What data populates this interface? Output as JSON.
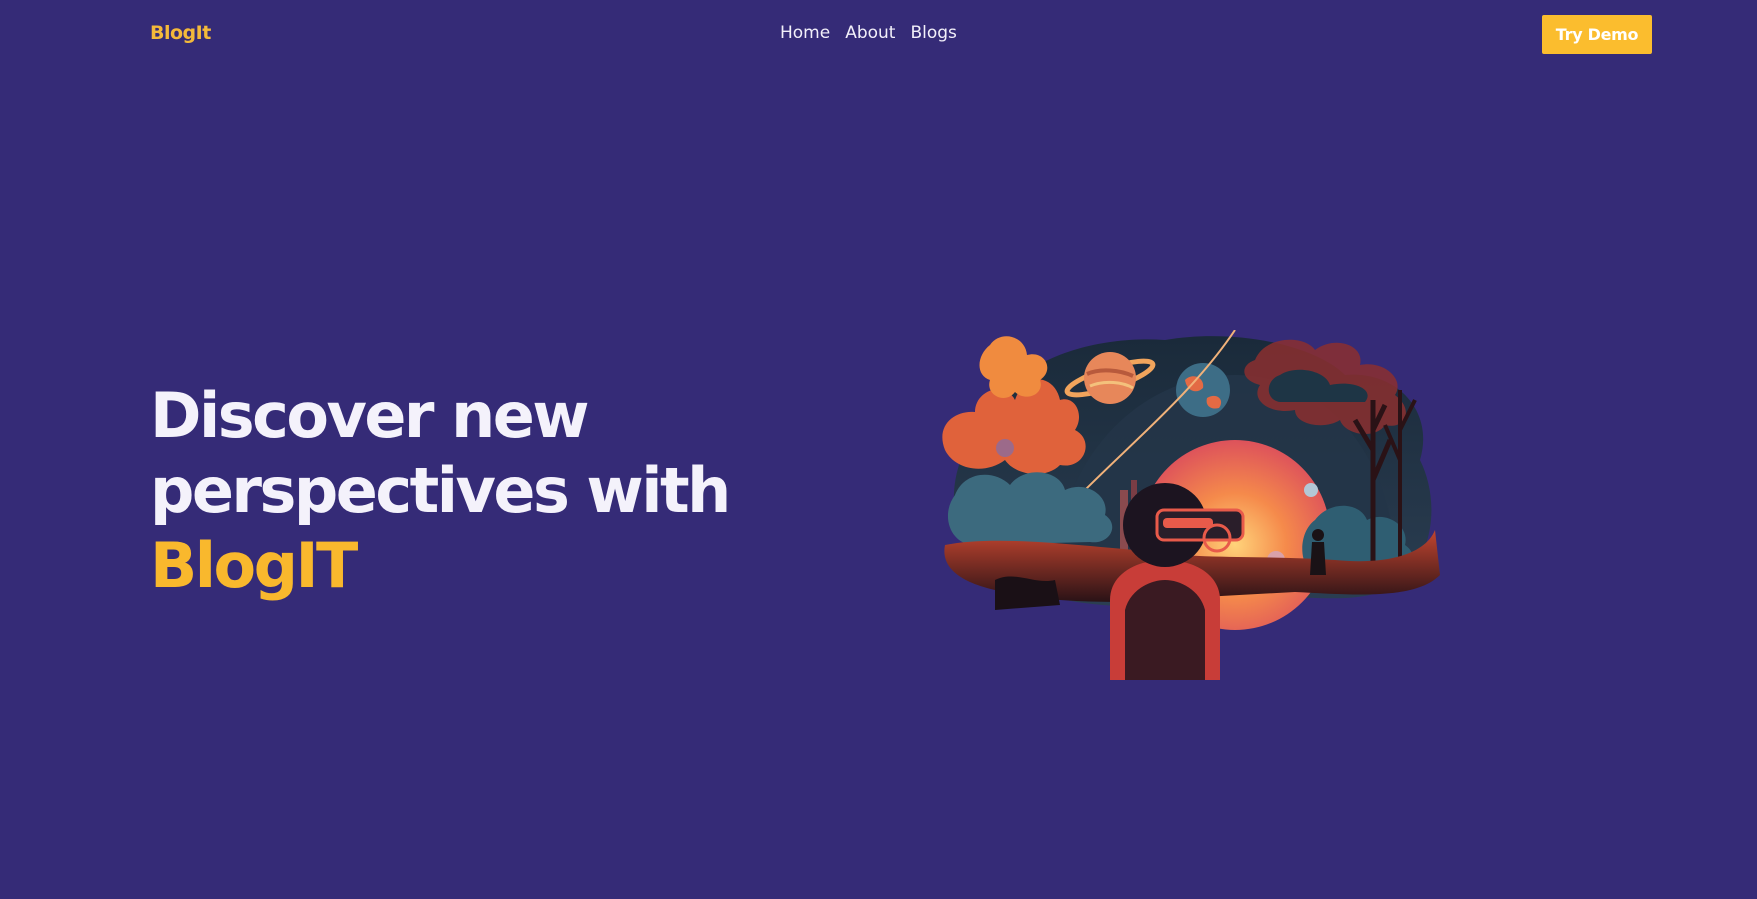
{
  "header": {
    "logo": "BlogIt",
    "nav": [
      {
        "label": "Home"
      },
      {
        "label": "About"
      },
      {
        "label": "Blogs"
      }
    ],
    "cta_label": "Try Demo"
  },
  "hero": {
    "line1": "Discover new",
    "line2": "perspectives with",
    "line3": "BlogIT",
    "image_icon": "vr-space-illustration"
  },
  "colors": {
    "background": "#352b77",
    "accent": "#f9b82d",
    "button": "#fbbd2e",
    "text": "#f4f2fb"
  }
}
